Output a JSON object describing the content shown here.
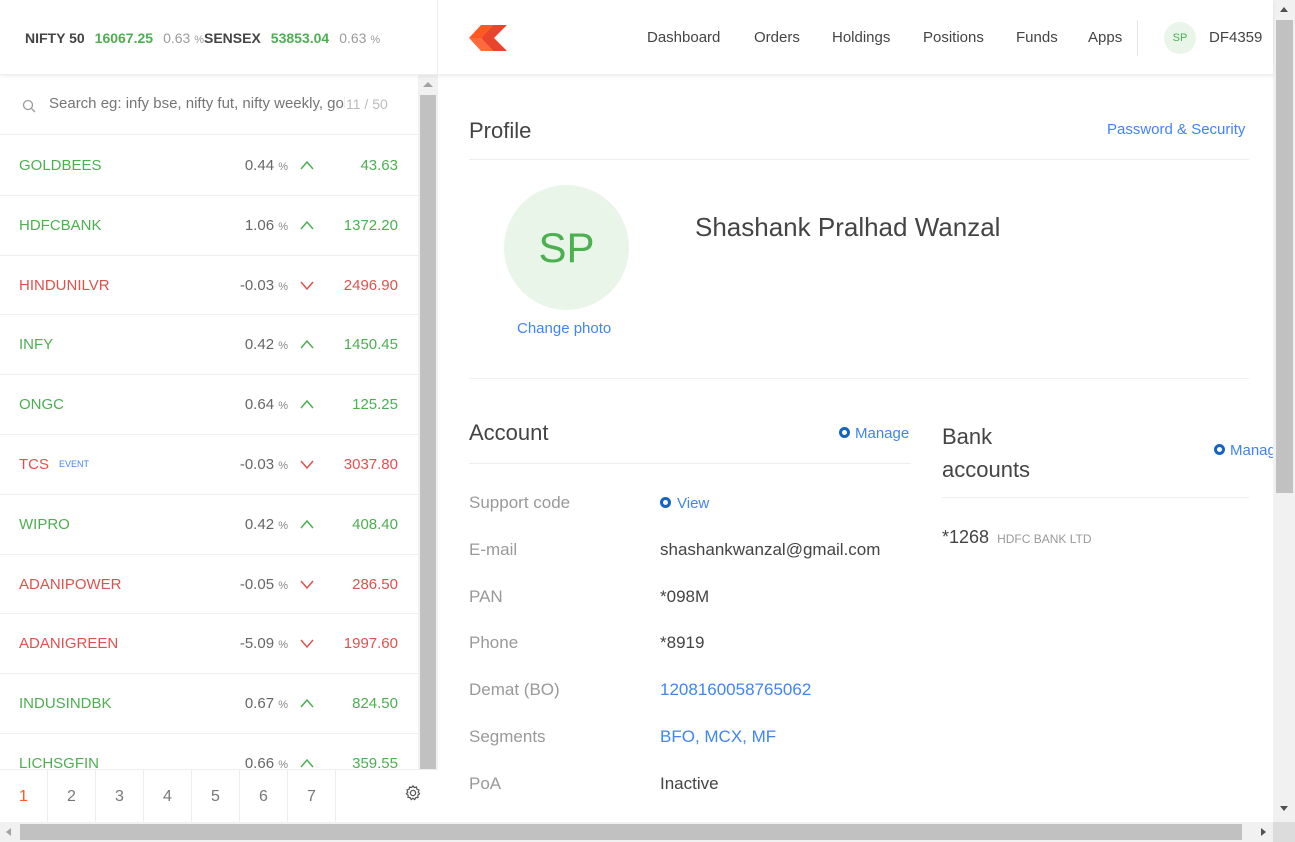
{
  "indices": [
    {
      "name": "NIFTY 50",
      "value": "16067.25",
      "change": "0.63",
      "unit": "%"
    },
    {
      "name": "SENSEX",
      "value": "53853.04",
      "change": "0.63",
      "unit": "%"
    }
  ],
  "nav": {
    "items": [
      "Dashboard",
      "Orders",
      "Holdings",
      "Positions",
      "Funds",
      "Apps"
    ],
    "avatar_initials": "SP",
    "user_id": "DF4359"
  },
  "search": {
    "placeholder": "Search eg: infy bse, nifty fut, nifty weekly, gold mcx",
    "count": "11 / 50"
  },
  "watchlist": [
    {
      "symbol": "GOLDBEES",
      "change": "0.44",
      "ltp": "43.63",
      "direction": "up",
      "badge": ""
    },
    {
      "symbol": "HDFCBANK",
      "change": "1.06",
      "ltp": "1372.20",
      "direction": "up",
      "badge": ""
    },
    {
      "symbol": "HINDUNILVR",
      "change": "-0.03",
      "ltp": "2496.90",
      "direction": "down",
      "badge": ""
    },
    {
      "symbol": "INFY",
      "change": "0.42",
      "ltp": "1450.45",
      "direction": "up",
      "badge": ""
    },
    {
      "symbol": "ONGC",
      "change": "0.64",
      "ltp": "125.25",
      "direction": "up",
      "badge": ""
    },
    {
      "symbol": "TCS",
      "change": "-0.03",
      "ltp": "3037.80",
      "direction": "down",
      "badge": "EVENT"
    },
    {
      "symbol": "WIPRO",
      "change": "0.42",
      "ltp": "408.40",
      "direction": "up",
      "badge": ""
    },
    {
      "symbol": "ADANIPOWER",
      "change": "-0.05",
      "ltp": "286.50",
      "direction": "down",
      "badge": ""
    },
    {
      "symbol": "ADANIGREEN",
      "change": "-5.09",
      "ltp": "1997.60",
      "direction": "down",
      "badge": ""
    },
    {
      "symbol": "INDUSINDBK",
      "change": "0.67",
      "ltp": "824.50",
      "direction": "up",
      "badge": ""
    },
    {
      "symbol": "LICHSGFIN",
      "change": "0.66",
      "ltp": "359.55",
      "direction": "up",
      "badge": ""
    }
  ],
  "watchlist_unit": "%",
  "pages": [
    "1",
    "2",
    "3",
    "4",
    "5",
    "6",
    "7"
  ],
  "active_page": "1",
  "profile": {
    "title": "Profile",
    "password_link": "Password & Security",
    "initials": "SP",
    "change_photo": "Change photo",
    "full_name": "Shashank Pralhad Wanzal"
  },
  "account": {
    "title": "Account",
    "manage": "Manage",
    "fields": [
      {
        "label": "Support code",
        "value": "View",
        "type": "action"
      },
      {
        "label": "E-mail",
        "value": "shashankwanzal@gmail.com",
        "type": "text"
      },
      {
        "label": "PAN",
        "value": "*098M",
        "type": "text"
      },
      {
        "label": "Phone",
        "value": "*8919",
        "type": "text"
      },
      {
        "label": "Demat (BO)",
        "value": "1208160058765062",
        "type": "link"
      },
      {
        "label": "Segments",
        "value": "BFO, MCX, MF",
        "type": "link"
      },
      {
        "label": "PoA",
        "value": "Inactive",
        "type": "text"
      }
    ]
  },
  "bank": {
    "title": "Bank accounts",
    "manage": "Manage",
    "account_number": "*1268",
    "bank_name": "HDFC BANK LTD"
  },
  "colors": {
    "up": "#4caf50",
    "down": "#df514c",
    "link": "#4184f3",
    "brand": "#ff5722",
    "active_page": "#ff5722"
  }
}
